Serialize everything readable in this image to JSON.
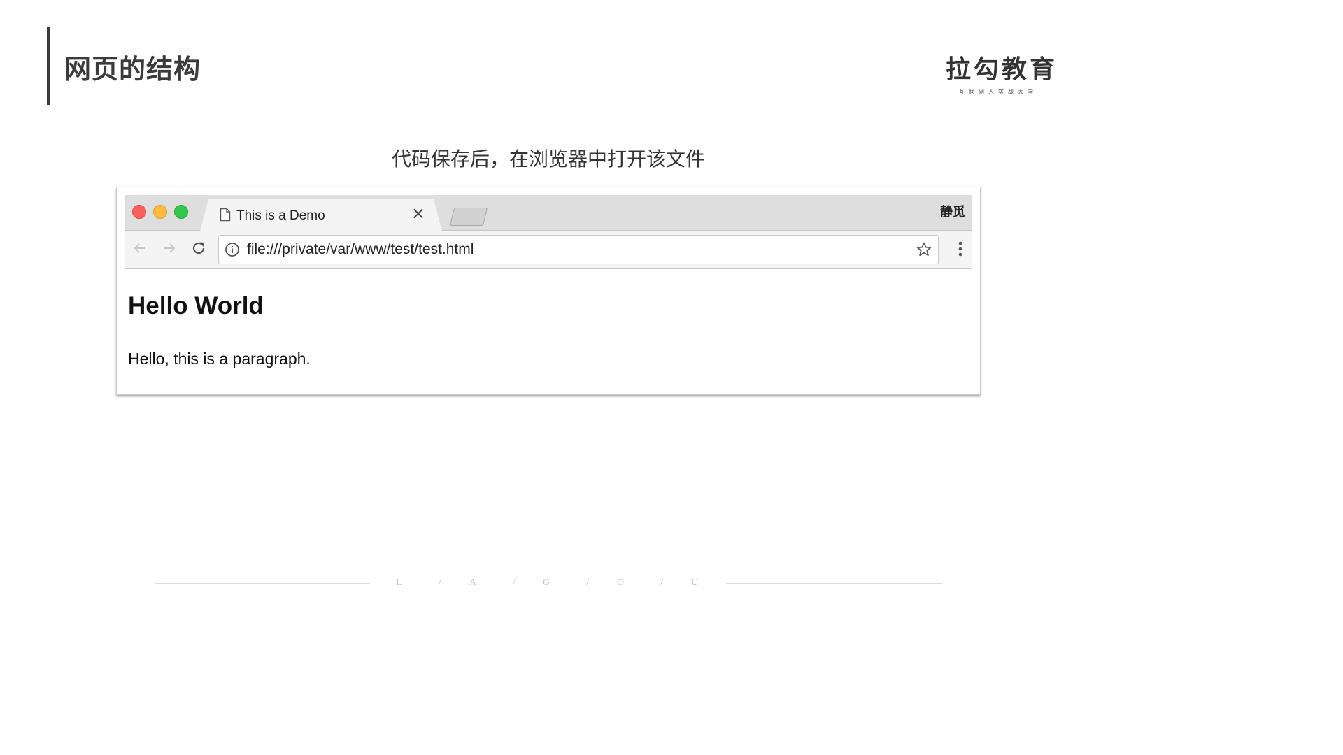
{
  "slide": {
    "title": "网页的结构",
    "subtitle": "代码保存后，在浏览器中打开该文件"
  },
  "logo": {
    "text": "拉勾教育",
    "tagline": "互联网人实战大学"
  },
  "browser": {
    "tab": {
      "title": "This is a Demo",
      "close_icon": "×",
      "icon": "document-icon"
    },
    "profile_label": "静觅",
    "address_bar": {
      "url": "file:///private/var/www/test/test.html",
      "info_icon": "info-icon",
      "bookmark_icon": "star-icon"
    },
    "nav": {
      "back_icon": "arrow-left-icon",
      "forward_icon": "arrow-right-icon",
      "reload_icon": "reload-icon",
      "menu_icon": "kebab-menu-icon"
    },
    "page": {
      "heading": "Hello World",
      "paragraph": "Hello, this is a paragraph."
    },
    "colors": {
      "close_light": "#fc605c",
      "minimize_light": "#fdbc40",
      "maximize_light": "#34c84a"
    }
  },
  "footer": {
    "letters": [
      "L",
      "/",
      "A",
      "/",
      "G",
      "/",
      "O",
      "/",
      "U"
    ]
  }
}
